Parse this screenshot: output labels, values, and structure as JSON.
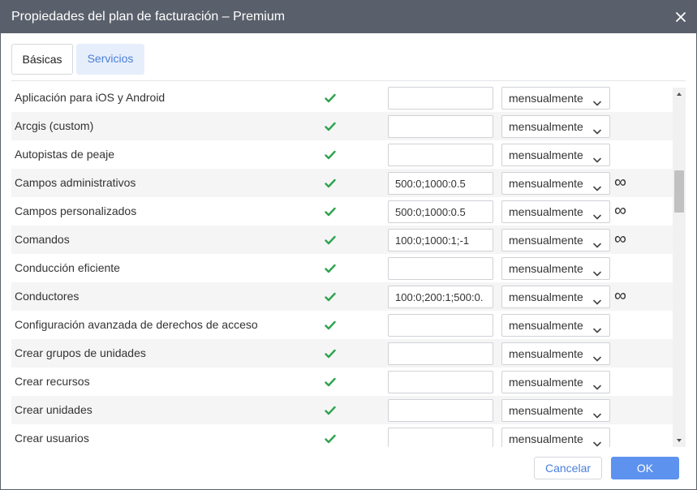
{
  "window": {
    "title": "Propiedades del plan de facturación – Premium"
  },
  "tabs": [
    {
      "label": "Básicas"
    },
    {
      "label": "Servicios"
    }
  ],
  "services": [
    {
      "name": "Aplicación para iOS y Android",
      "enabled": true,
      "cost": "",
      "period": "mensualmente",
      "unlimited": false
    },
    {
      "name": "Arcgis (custom)",
      "enabled": true,
      "cost": "",
      "period": "mensualmente",
      "unlimited": false
    },
    {
      "name": "Autopistas de peaje",
      "enabled": true,
      "cost": "",
      "period": "mensualmente",
      "unlimited": false
    },
    {
      "name": "Campos administrativos",
      "enabled": true,
      "cost": "500:0;1000:0.5",
      "period": "mensualmente",
      "unlimited": true
    },
    {
      "name": "Campos personalizados",
      "enabled": true,
      "cost": "500:0;1000:0.5",
      "period": "mensualmente",
      "unlimited": true
    },
    {
      "name": "Comandos",
      "enabled": true,
      "cost": "100:0;1000:1;-1",
      "period": "mensualmente",
      "unlimited": true
    },
    {
      "name": "Conducción eficiente",
      "enabled": true,
      "cost": "",
      "period": "mensualmente",
      "unlimited": false
    },
    {
      "name": "Conductores",
      "enabled": true,
      "cost": "100:0;200:1;500:0.",
      "period": "mensualmente",
      "unlimited": true
    },
    {
      "name": "Configuración avanzada de derechos de acceso",
      "enabled": true,
      "cost": "",
      "period": "mensualmente",
      "unlimited": false
    },
    {
      "name": "Crear grupos de unidades",
      "enabled": true,
      "cost": "",
      "period": "mensualmente",
      "unlimited": false
    },
    {
      "name": "Crear recursos",
      "enabled": true,
      "cost": "",
      "period": "mensualmente",
      "unlimited": false
    },
    {
      "name": "Crear unidades",
      "enabled": true,
      "cost": "",
      "period": "mensualmente",
      "unlimited": false
    },
    {
      "name": "Crear usuarios",
      "enabled": true,
      "cost": "",
      "period": "mensualmente",
      "unlimited": false
    }
  ],
  "unlimited_symbol": "∞",
  "footer": {
    "cancel_label": "Cancelar",
    "ok_label": "OK"
  },
  "colors": {
    "titlebar": "#5a606b",
    "accent": "#5e92ef",
    "tab_active_bg": "#e7eefb",
    "check": "#2fa34e"
  },
  "icons": {
    "close": "close-icon",
    "check": "checkmark-icon",
    "dropdown": "chevron-down-icon",
    "scroll_up": "arrow-up-icon",
    "scroll_down": "arrow-down-icon"
  }
}
